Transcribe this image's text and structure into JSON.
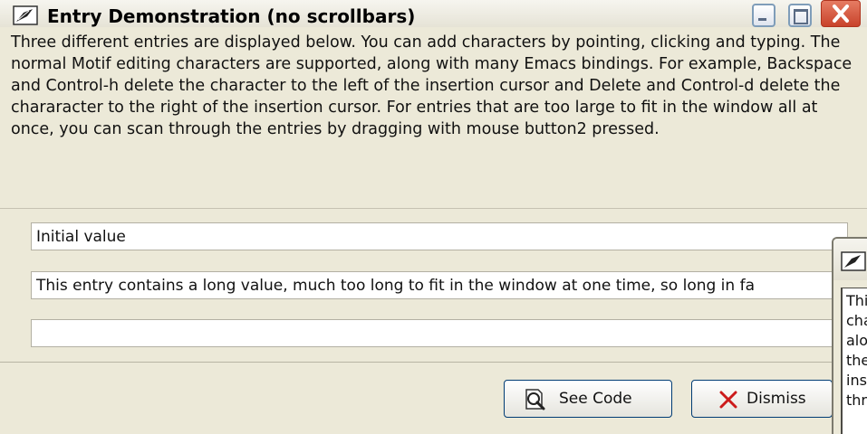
{
  "window": {
    "title": "Entry Demonstration (no scrollbars)",
    "icon": "feather-icon"
  },
  "description": "Three different entries are displayed below.  You can add characters by pointing, clicking and typing.  The normal Motif editing characters are supported, along with many Emacs bindings.  For example, Backspace and Control-h delete the character to the left of the insertion cursor and Delete and Control-d delete the chararacter to the right of the insertion cursor.  For entries that are too large to fit in the window all at once, you can scan through the entries by dragging with mouse button2 pressed.",
  "entries": [
    {
      "value": "Initial value"
    },
    {
      "value": "This entry contains a long value, much too long to fit in the window at one time, so long in fa"
    },
    {
      "value": ""
    }
  ],
  "buttons": {
    "see_code": "See Code",
    "dismiss": "Dismiss"
  },
  "background_window": {
    "lines": [
      "Thi",
      "cha",
      "alo",
      "the",
      "ins",
      "thr"
    ]
  },
  "colors": {
    "dialog_bg": "#ece9d8",
    "close_button": "#c8432b",
    "dismiss_x": "#cc1a1a"
  }
}
